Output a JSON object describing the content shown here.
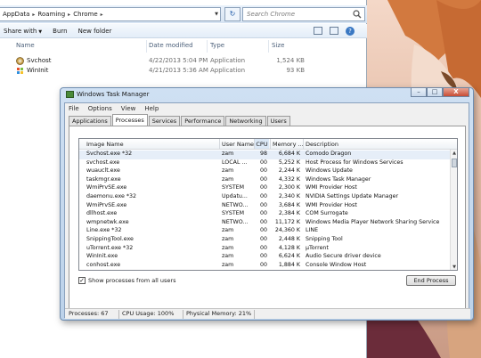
{
  "explorer": {
    "address_crumbs": [
      "AppData",
      "Roaming",
      "Chrome"
    ],
    "search_placeholder": "Search Chrome",
    "commands": {
      "organize": "Share with",
      "burn": "Burn",
      "new_folder": "New folder"
    },
    "columns": {
      "name": "Name",
      "date": "Date modified",
      "type": "Type",
      "size": "Size"
    },
    "files": [
      {
        "name": "Svchost",
        "date": "4/22/2013 5:04 PM",
        "type": "Application",
        "size": "1,524 KB",
        "icon": "app-globe-icon"
      },
      {
        "name": "WinInit",
        "date": "4/21/2013 5:36 AM",
        "type": "Application",
        "size": "93 KB",
        "icon": "app-winlogo-icon"
      }
    ]
  },
  "taskmgr": {
    "title": "Windows Task Manager",
    "caption_buttons": {
      "minimize": "–",
      "maximize": "□",
      "close": "X"
    },
    "menu": [
      "File",
      "Options",
      "View",
      "Help"
    ],
    "tabs": [
      "Applications",
      "Processes",
      "Services",
      "Performance",
      "Networking",
      "Users"
    ],
    "active_tab": "Processes",
    "columns": {
      "image": "Image Name",
      "user": "User Name",
      "cpu": "CPU",
      "memory": "Memory ...",
      "description": "Description"
    },
    "processes": [
      {
        "image": "Svchost.exe *32",
        "user": "zam",
        "cpu": "98",
        "memory": "6,684 K",
        "description": "Comodo Dragon"
      },
      {
        "image": "svchost.exe",
        "user": "LOCAL ...",
        "cpu": "00",
        "memory": "5,252 K",
        "description": "Host Process for Windows Services"
      },
      {
        "image": "wuauclt.exe",
        "user": "zam",
        "cpu": "00",
        "memory": "2,244 K",
        "description": "Windows Update"
      },
      {
        "image": "taskmgr.exe",
        "user": "zam",
        "cpu": "00",
        "memory": "4,332 K",
        "description": "Windows Task Manager"
      },
      {
        "image": "WmiPrvSE.exe",
        "user": "SYSTEM",
        "cpu": "00",
        "memory": "2,300 K",
        "description": "WMI Provider Host"
      },
      {
        "image": "daemonu.exe *32",
        "user": "Updatu...",
        "cpu": "00",
        "memory": "2,340 K",
        "description": "NVIDIA Settings Update Manager"
      },
      {
        "image": "WmiPrvSE.exe",
        "user": "NETWO...",
        "cpu": "00",
        "memory": "3,684 K",
        "description": "WMI Provider Host"
      },
      {
        "image": "dllhost.exe",
        "user": "SYSTEM",
        "cpu": "00",
        "memory": "2,384 K",
        "description": "COM Surrogate"
      },
      {
        "image": "wmpnetwk.exe",
        "user": "NETWO...",
        "cpu": "00",
        "memory": "11,172 K",
        "description": "Windows Media Player Network Sharing Service"
      },
      {
        "image": "Line.exe *32",
        "user": "zam",
        "cpu": "00",
        "memory": "24,360 K",
        "description": "LINE"
      },
      {
        "image": "SnippingTool.exe",
        "user": "zam",
        "cpu": "00",
        "memory": "2,448 K",
        "description": "Snipping Tool"
      },
      {
        "image": "uTorrent.exe *32",
        "user": "zam",
        "cpu": "00",
        "memory": "4,128 K",
        "description": "µTorrent"
      },
      {
        "image": "WinInit.exe",
        "user": "zam",
        "cpu": "00",
        "memory": "6,624 K",
        "description": "Audio Secure driver device"
      },
      {
        "image": "conhost.exe",
        "user": "zam",
        "cpu": "00",
        "memory": "1,884 K",
        "description": "Console Window Host"
      }
    ],
    "show_all_label": "Show processes from all users",
    "show_all_checked": "✓",
    "end_process_label": "End Process",
    "status": {
      "processes": "Processes: 67",
      "cpu": "CPU Usage: 100%",
      "memory": "Physical Memory: 21%"
    }
  }
}
